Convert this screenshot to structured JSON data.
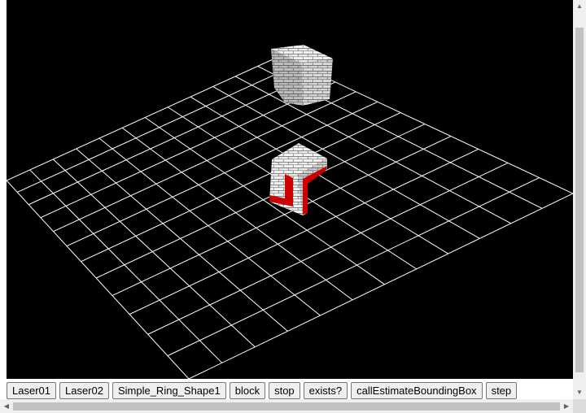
{
  "toolbar": {
    "buttons": [
      "Laser01",
      "Laser02",
      "Simple_Ring_Shape1",
      "block",
      "stop",
      "exists?",
      "callEstimateBoundingBox",
      "step"
    ]
  },
  "scene": {
    "background_color": "#000000",
    "grid_color": "#ffffff",
    "grid_divisions": 12,
    "objects": [
      "stone-brick-cube",
      "stone-brick-cube-with-red-marker"
    ],
    "marker_color": "#cc0000"
  },
  "scrollbars": {
    "up_icon": "▲",
    "down_icon": "▼",
    "left_icon": "◀",
    "right_icon": "▶"
  }
}
